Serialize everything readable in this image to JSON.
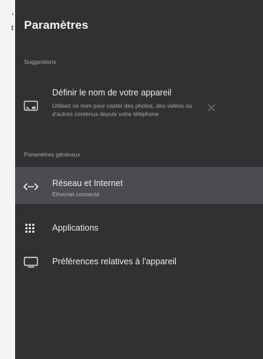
{
  "edge_fragments": [
    "'",
    "t"
  ],
  "panel": {
    "title": "Paramètres",
    "sections": {
      "suggestions": "Suggestions",
      "general": "Paramètres généraux"
    },
    "suggestion": {
      "icon": "cast-screen-icon",
      "title": "Définir le nom de votre appareil",
      "description": "Utilisez ce nom pour caster des photos, des vidéos ou d'autres contenus depuis votre téléphone",
      "dismiss_icon": "close-icon"
    },
    "items": [
      {
        "icon": "network-icon",
        "title": "Réseau et Internet",
        "subtitle": "Ethernet connecté",
        "selected": true
      },
      {
        "icon": "apps-grid-icon",
        "title": "Applications"
      },
      {
        "icon": "tv-icon",
        "title": "Préférences relatives à l'appareil"
      }
    ]
  },
  "colors": {
    "panel_background": "#303133",
    "selected_row": "#4b4c4f",
    "text_primary": "#ececec",
    "text_secondary": "#a8a8a8",
    "page_background": "#f4f4f4"
  }
}
